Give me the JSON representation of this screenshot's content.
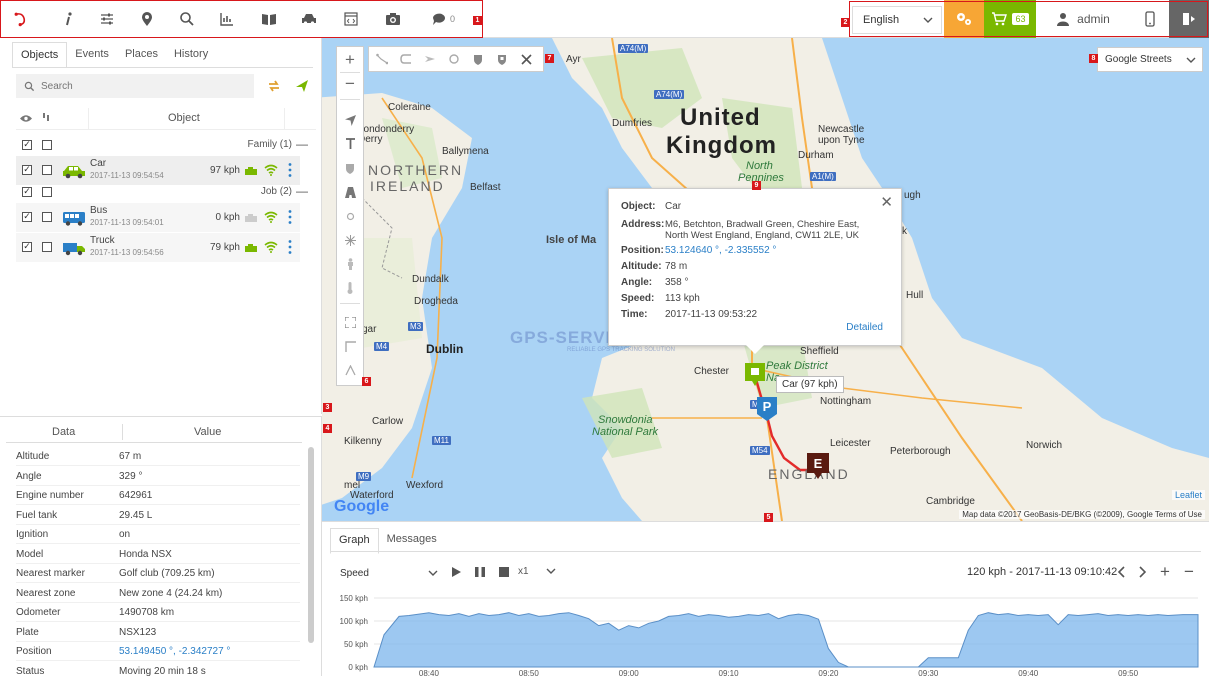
{
  "topbar": {
    "icons": [
      "logo-icon",
      "info-icon",
      "sliders-icon",
      "map-pin-icon",
      "search-icon",
      "chart-icon",
      "book-icon",
      "car-icon",
      "code-icon",
      "camera-icon",
      "chat-icon"
    ],
    "message_count": "0",
    "language": "English",
    "cart_count": "63",
    "username": "admin"
  },
  "markers": [
    "1",
    "2",
    "3",
    "4",
    "5",
    "6",
    "7",
    "8",
    "9"
  ],
  "left": {
    "tabs": [
      "Objects",
      "Events",
      "Places",
      "History"
    ],
    "search_placeholder": "Search",
    "column_object": "Object",
    "groups": [
      {
        "name": "Family (1)",
        "collapse": "—"
      },
      {
        "name": "Job (2)",
        "collapse": "—"
      }
    ],
    "objects": [
      {
        "name": "Car",
        "time": "2017-11-13 09:54:54",
        "speed": "97 kph",
        "icon": "car-icon",
        "color": "#7ab800"
      },
      {
        "name": "Bus",
        "time": "2017-11-13 09:54:01",
        "speed": "0 kph",
        "icon": "bus-icon",
        "color": "#2a7fc7"
      },
      {
        "name": "Truck",
        "time": "2017-11-13 09:54:56",
        "speed": "79 kph",
        "icon": "truck-icon",
        "color": "#2a7fc7"
      }
    ]
  },
  "data_panel": {
    "col_data": "Data",
    "col_value": "Value",
    "rows": [
      {
        "k": "Altitude",
        "v": "67 m"
      },
      {
        "k": "Angle",
        "v": "329 °"
      },
      {
        "k": "Engine number",
        "v": "642961"
      },
      {
        "k": "Fuel tank",
        "v": "29.45 L"
      },
      {
        "k": "Ignition",
        "v": "on"
      },
      {
        "k": "Model",
        "v": "Honda NSX"
      },
      {
        "k": "Nearest marker",
        "v": "Golf club (709.25 km)"
      },
      {
        "k": "Nearest zone",
        "v": "New zone 4 (24.24 km)"
      },
      {
        "k": "Odometer",
        "v": "1490708 km"
      },
      {
        "k": "Plate",
        "v": "NSX123"
      },
      {
        "k": "Position",
        "v": "53.149450 °, -2.342727 °"
      },
      {
        "k": "Status",
        "v": "Moving 20 min 18 s"
      }
    ]
  },
  "map": {
    "layer": "Google Streets",
    "zoom_in": "+",
    "zoom_out": "−",
    "labels": {
      "uk": "United",
      "uk2": "Kingdom",
      "ni1": "NORTHERN",
      "ni2": "IRELAND",
      "england": "ENGLAND",
      "isle": "Isle of Ma",
      "dublin": "Dublin",
      "belfast": "Belfast",
      "derry": "Londonderry",
      "derry2": "Derry",
      "coleraine": "Coleraine",
      "ballymena": "Ballymena",
      "dundalk": "Dundalk",
      "drogheda": "Drogheda",
      "carlow": "Carlow",
      "kilkenny": "Kilkenny",
      "waterford": "Waterford",
      "wexford": "Wexford",
      "dumfries": "Dumfries",
      "ayr": "Ayr",
      "newcastle": "Newcastle",
      "newcastle2": "upon Tyne",
      "durham": "Durham",
      "np1": "North",
      "np2": "Pennines",
      "hull": "Hull",
      "chester": "Chester",
      "nottingham": "Nottingham",
      "leicester": "Leicester",
      "peterborough": "Peterborough",
      "norwich": "Norwich",
      "cambridge": "Cambridge",
      "snow1": "Snowdonia",
      "snow2": "National Park",
      "peak1": "Peak District",
      "peak2": "Na",
      "sheffield": "Sheffield",
      "gar": "gar",
      "sk": "sk",
      "mel": "mel",
      "ugh": "ugh",
      "k": "k"
    },
    "roads": [
      "A74(M)",
      "A1(M)",
      "M3",
      "M4",
      "M11",
      "M9",
      "M6",
      "M54"
    ],
    "popup": {
      "rows": [
        {
          "k": "Object:",
          "v": "Car"
        },
        {
          "k": "Address:",
          "v": "M6, Betchton, Bradwall Green, Cheshire East,"
        },
        {
          "k": "",
          "v": "North West England, England, CW11 2LE, UK"
        },
        {
          "k": "Position:",
          "v": "53.124640 °, -2.335552 °"
        },
        {
          "k": "Altitude:",
          "v": "78 m"
        },
        {
          "k": "Angle:",
          "v": "358 °"
        },
        {
          "k": "Speed:",
          "v": "113 kph"
        },
        {
          "k": "Time:",
          "v": "2017-11-13 09:53:22"
        }
      ],
      "detailed": "Detailed",
      "close": "✕"
    },
    "tooltip": "Car (97 kph)",
    "parking_label": "P",
    "end_label": "E",
    "leaflet": "Leaflet",
    "attribution": "Map data ©2017 GeoBasis-DE/BKG (©2009), Google   Terms of Use",
    "google": "Google",
    "watermark": "GPS-SERVER",
    "watermark_sub": "RELIABLE GPS TRACKING SOLUTION"
  },
  "graph": {
    "tabs": [
      "Graph",
      "Messages"
    ],
    "select": "Speed",
    "speed": "x1",
    "readout": "120 kph - 2017-11-13 09:10:42"
  },
  "chart_data": {
    "type": "area",
    "ylabel": "",
    "ylim": [
      0,
      150
    ],
    "yticks": [
      "150 kph",
      "100 kph",
      "50 kph",
      "0 kph"
    ],
    "ytick_values": [
      150,
      100,
      50,
      0
    ],
    "xticks": [
      "08:40",
      "08:50",
      "09:00",
      "09:10",
      "09:20",
      "09:30",
      "09:40",
      "09:50"
    ],
    "xtick_minutes": [
      520,
      530,
      540,
      550,
      560,
      570,
      580,
      590
    ],
    "x_minutes": [
      514.5,
      515.5,
      517,
      518,
      520,
      521,
      522,
      523,
      524,
      525,
      526,
      527,
      528,
      529,
      530,
      531,
      532,
      533,
      534,
      535,
      536,
      537,
      538,
      539,
      540,
      541,
      542,
      543,
      544,
      545,
      546,
      547,
      548,
      549,
      550,
      551,
      552,
      553,
      554,
      555,
      556,
      557,
      558,
      559,
      560,
      561,
      562,
      563,
      564,
      565,
      566,
      567,
      568,
      569,
      570,
      571,
      572,
      573,
      574,
      575,
      576,
      577,
      578,
      579,
      580,
      581,
      582,
      583,
      584,
      585,
      586,
      587,
      588,
      589,
      590,
      591,
      592,
      593,
      594,
      595.5,
      597
    ],
    "values": [
      0,
      70,
      110,
      112,
      118,
      114,
      112,
      116,
      110,
      116,
      112,
      114,
      118,
      112,
      116,
      110,
      112,
      116,
      118,
      112,
      105,
      90,
      95,
      80,
      90,
      85,
      95,
      100,
      110,
      112,
      116,
      110,
      114,
      112,
      108,
      110,
      114,
      112,
      116,
      105,
      112,
      115,
      112,
      104,
      40,
      10,
      0,
      0,
      0,
      0,
      0,
      0,
      0,
      0,
      20,
      20,
      20,
      20,
      80,
      112,
      118,
      114,
      116,
      112,
      114,
      112,
      114,
      92,
      114,
      112,
      114,
      116,
      112,
      114,
      112,
      114,
      112,
      114,
      112,
      114,
      114
    ],
    "color": "#7cb5ec"
  }
}
